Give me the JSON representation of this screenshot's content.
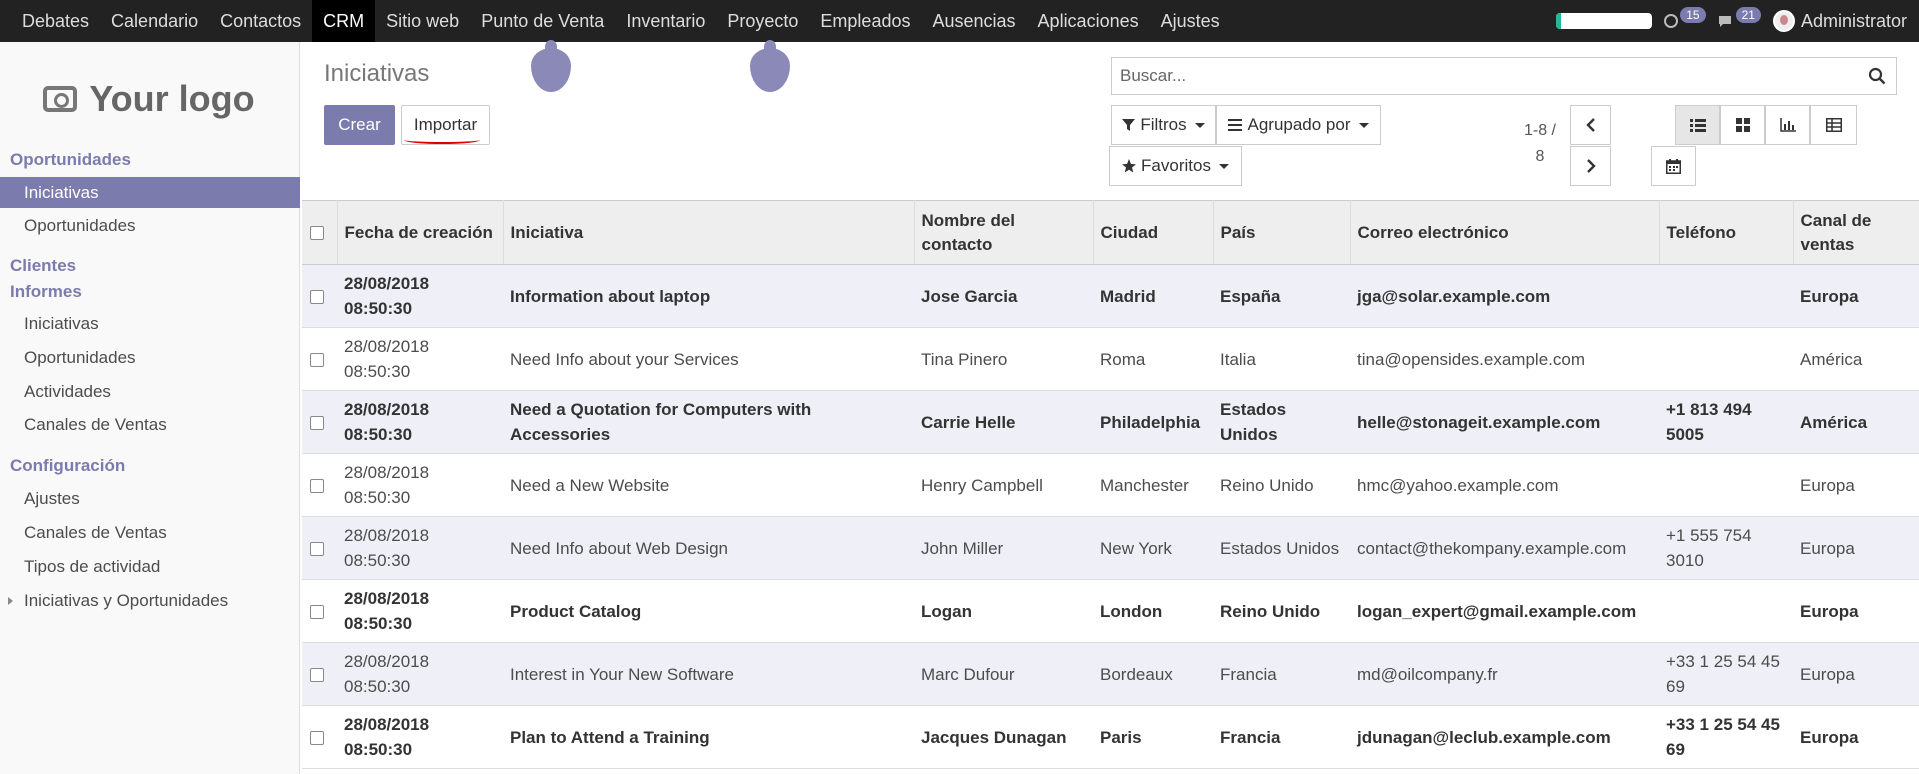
{
  "topbar": {
    "menu": [
      "Debates",
      "Calendario",
      "Contactos",
      "CRM",
      "Sitio web",
      "Punto de Venta",
      "Inventario",
      "Proyecto",
      "Empleados",
      "Ausencias",
      "Aplicaciones",
      "Ajustes"
    ],
    "active_menu": "CRM",
    "progress_fraction": 0.05,
    "activities_count": "15",
    "messages_count": "21",
    "user_name": "Administrator"
  },
  "sidebar": {
    "logo_text": "Your logo",
    "sections": {
      "oportunidades": "Oportunidades",
      "clientes": "Clientes",
      "informes": "Informes",
      "configuracion": "Configuración"
    },
    "items": {
      "iniciativas": "Iniciativas",
      "oportunidades": "Oportunidades",
      "inf_iniciativas": "Iniciativas",
      "inf_oportunidades": "Oportunidades",
      "inf_actividades": "Actividades",
      "inf_canales": "Canales de Ventas",
      "conf_ajustes": "Ajustes",
      "conf_canales": "Canales de Ventas",
      "conf_tipos": "Tipos de actividad",
      "conf_iniciativas_op": "Iniciativas y Oportunidades"
    }
  },
  "control_panel": {
    "title": "Iniciativas",
    "create_label": "Crear",
    "import_label": "Importar",
    "search_placeholder": "Buscar...",
    "filters_label": "Filtros",
    "group_by_label": "Agrupado por",
    "favorites_label": "Favoritos",
    "pager_range": "1-8 /",
    "pager_total": "8"
  },
  "table": {
    "headers": [
      "Fecha de creación",
      "Iniciativa",
      "Nombre del contacto",
      "Ciudad",
      "País",
      "Correo electrónico",
      "Teléfono",
      "Canal de ventas"
    ],
    "rows": [
      {
        "date": "28/08/2018 08:50:30",
        "name": "Information about laptop",
        "contact": "Jose Garcia",
        "city": "Madrid",
        "country": "España",
        "email": "jga@solar.example.com",
        "phone": "",
        "channel": "Europa",
        "bold": true
      },
      {
        "date": "28/08/2018 08:50:30",
        "name": "Need Info about your Services",
        "contact": "Tina Pinero",
        "city": "Roma",
        "country": "Italia",
        "email": "tina@opensides.example.com",
        "phone": "",
        "channel": "América",
        "bold": false
      },
      {
        "date": "28/08/2018 08:50:30",
        "name": "Need a Quotation for Computers with Accessories",
        "contact": "Carrie Helle",
        "city": "Philadelphia",
        "country": "Estados Unidos",
        "email": "helle@stonageit.example.com",
        "phone": "+1 813 494 5005",
        "channel": "América",
        "bold": true
      },
      {
        "date": "28/08/2018 08:50:30",
        "name": "Need a New Website",
        "contact": "Henry Campbell",
        "city": "Manchester",
        "country": "Reino Unido",
        "email": "hmc@yahoo.example.com",
        "phone": "",
        "channel": "Europa",
        "bold": false
      },
      {
        "date": "28/08/2018 08:50:30",
        "name": "Need Info about Web Design",
        "contact": "John Miller",
        "city": "New York",
        "country": "Estados Unidos",
        "email": "contact@thekompany.example.com",
        "phone": "+1 555 754 3010",
        "channel": "Europa",
        "bold": false
      },
      {
        "date": "28/08/2018 08:50:30",
        "name": "Product Catalog",
        "contact": "Logan",
        "city": "London",
        "country": "Reino Unido",
        "email": "logan_expert@gmail.example.com",
        "phone": "",
        "channel": "Europa",
        "bold": true
      },
      {
        "date": "28/08/2018 08:50:30",
        "name": "Interest in Your New Software",
        "contact": "Marc Dufour",
        "city": "Bordeaux",
        "country": "Francia",
        "email": "md@oilcompany.fr",
        "phone": "+33 1 25 54 45 69",
        "channel": "Europa",
        "bold": false
      },
      {
        "date": "28/08/2018 08:50:30",
        "name": "Plan to Attend a Training",
        "contact": "Jacques Dunagan",
        "city": "Paris",
        "country": "Francia",
        "email": "jdunagan@leclub.example.com",
        "phone": "+33 1 25 54 45 69",
        "channel": "Europa",
        "bold": true
      }
    ]
  },
  "colors": {
    "brand": "#7c7bad",
    "topbar": "#222222",
    "row_alt": "#efeff7"
  }
}
